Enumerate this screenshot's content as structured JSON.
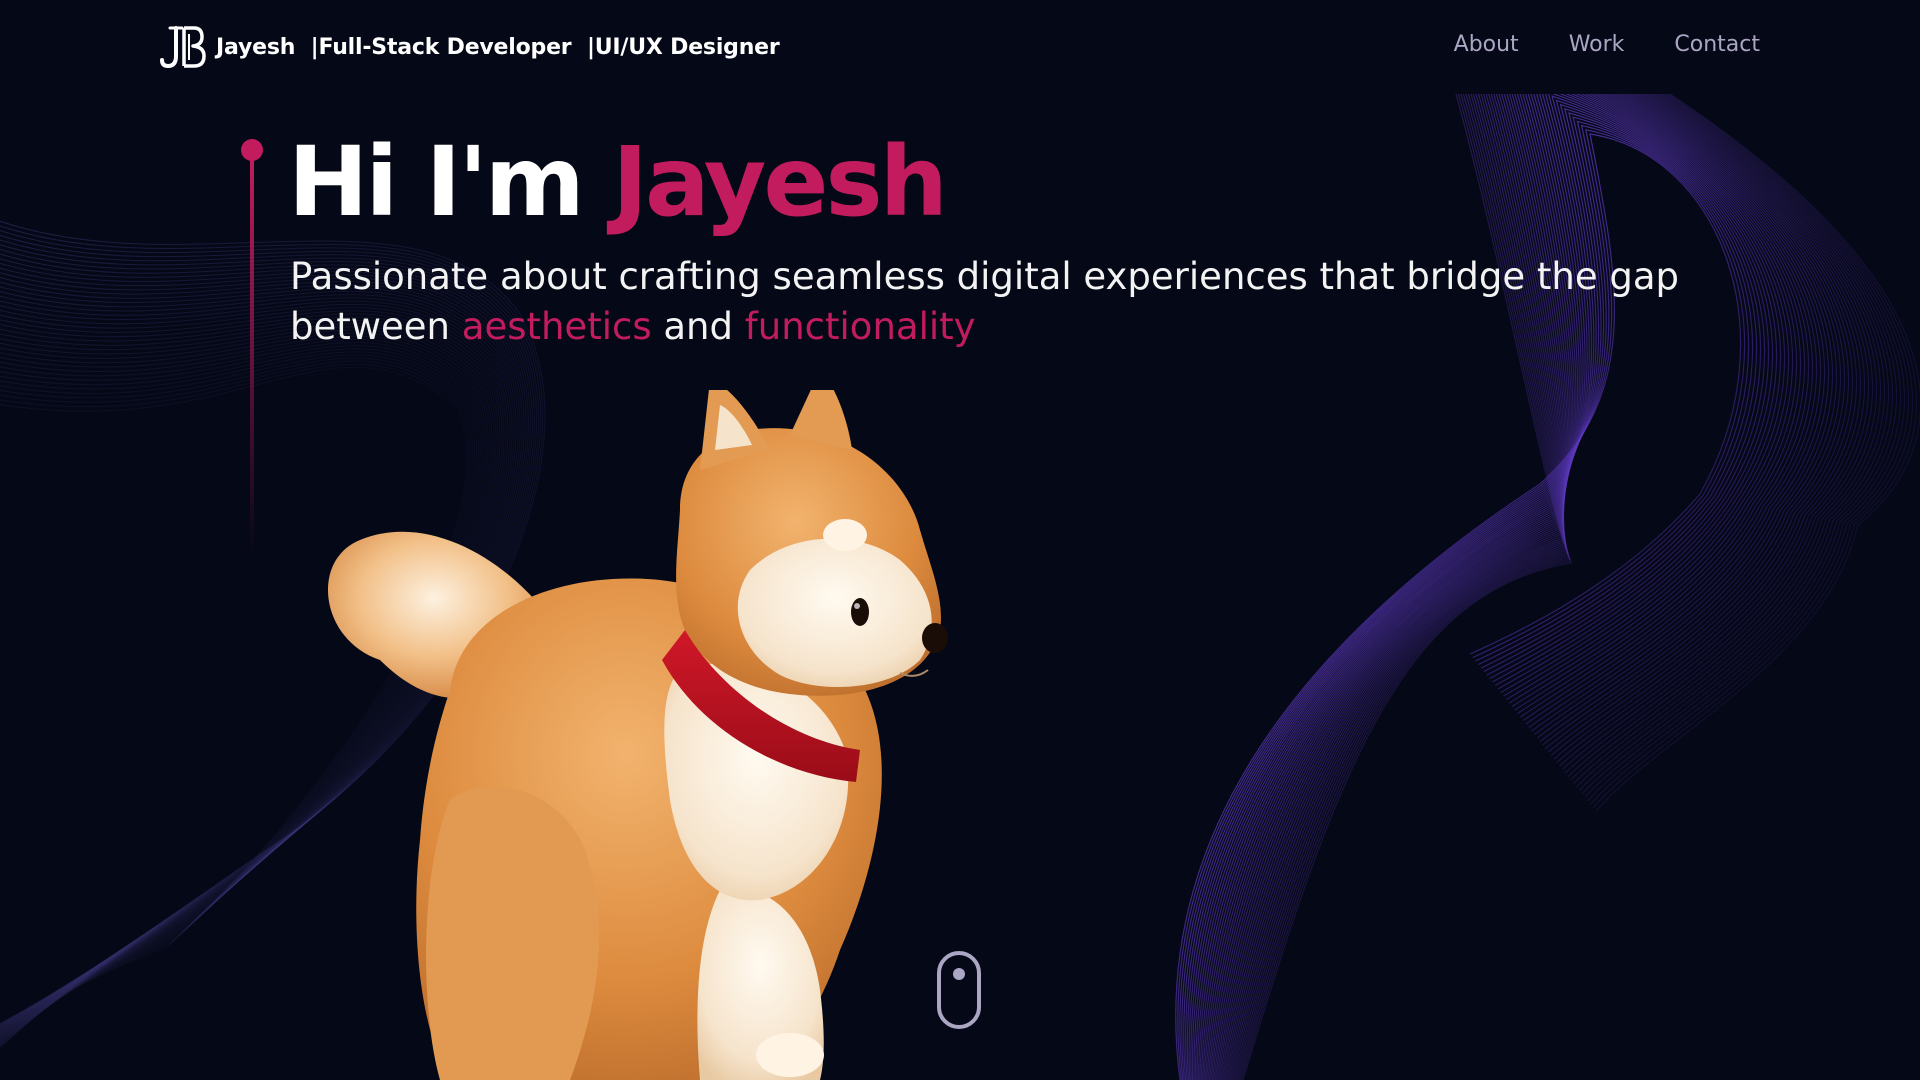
{
  "header": {
    "brand_name": "Jayesh",
    "brand_tag1": "|Full-Stack Developer",
    "brand_tag2": "|UI/UX Designer",
    "logo_icon": "jb-monogram-logo",
    "nav": [
      {
        "label": "About"
      },
      {
        "label": "Work"
      },
      {
        "label": "Contact"
      }
    ]
  },
  "hero": {
    "greeting": "Hi I'm ",
    "name": "Jayesh",
    "subtitle_part1": "Passionate about crafting seamless digital experiences that bridge the gap between ",
    "subtitle_accent1": "aesthetics",
    "subtitle_part2": " and ",
    "subtitle_accent2": "functionality"
  },
  "colors": {
    "background": "#050816",
    "accent": "#c21c5e",
    "nav_text": "#aaa6c3",
    "wave": "#6d3fd8"
  },
  "icons": {
    "scroll": "mouse-scroll-icon"
  }
}
